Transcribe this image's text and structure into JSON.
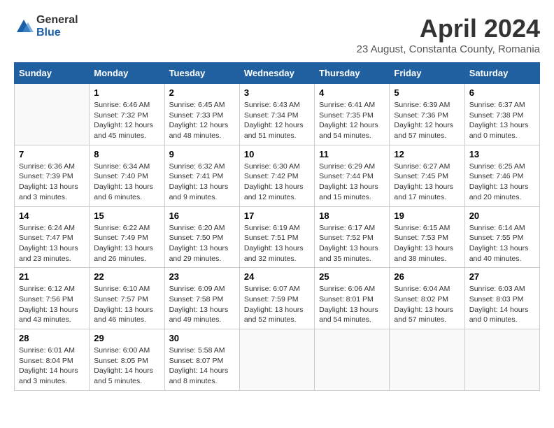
{
  "logo": {
    "general": "General",
    "blue": "Blue"
  },
  "title": "April 2024",
  "subtitle": "23 August, Constanta County, Romania",
  "days_of_week": [
    "Sunday",
    "Monday",
    "Tuesday",
    "Wednesday",
    "Thursday",
    "Friday",
    "Saturday"
  ],
  "weeks": [
    [
      {
        "day": "",
        "info": ""
      },
      {
        "day": "1",
        "info": "Sunrise: 6:46 AM\nSunset: 7:32 PM\nDaylight: 12 hours\nand 45 minutes."
      },
      {
        "day": "2",
        "info": "Sunrise: 6:45 AM\nSunset: 7:33 PM\nDaylight: 12 hours\nand 48 minutes."
      },
      {
        "day": "3",
        "info": "Sunrise: 6:43 AM\nSunset: 7:34 PM\nDaylight: 12 hours\nand 51 minutes."
      },
      {
        "day": "4",
        "info": "Sunrise: 6:41 AM\nSunset: 7:35 PM\nDaylight: 12 hours\nand 54 minutes."
      },
      {
        "day": "5",
        "info": "Sunrise: 6:39 AM\nSunset: 7:36 PM\nDaylight: 12 hours\nand 57 minutes."
      },
      {
        "day": "6",
        "info": "Sunrise: 6:37 AM\nSunset: 7:38 PM\nDaylight: 13 hours\nand 0 minutes."
      }
    ],
    [
      {
        "day": "7",
        "info": "Sunrise: 6:36 AM\nSunset: 7:39 PM\nDaylight: 13 hours\nand 3 minutes."
      },
      {
        "day": "8",
        "info": "Sunrise: 6:34 AM\nSunset: 7:40 PM\nDaylight: 13 hours\nand 6 minutes."
      },
      {
        "day": "9",
        "info": "Sunrise: 6:32 AM\nSunset: 7:41 PM\nDaylight: 13 hours\nand 9 minutes."
      },
      {
        "day": "10",
        "info": "Sunrise: 6:30 AM\nSunset: 7:42 PM\nDaylight: 13 hours\nand 12 minutes."
      },
      {
        "day": "11",
        "info": "Sunrise: 6:29 AM\nSunset: 7:44 PM\nDaylight: 13 hours\nand 15 minutes."
      },
      {
        "day": "12",
        "info": "Sunrise: 6:27 AM\nSunset: 7:45 PM\nDaylight: 13 hours\nand 17 minutes."
      },
      {
        "day": "13",
        "info": "Sunrise: 6:25 AM\nSunset: 7:46 PM\nDaylight: 13 hours\nand 20 minutes."
      }
    ],
    [
      {
        "day": "14",
        "info": "Sunrise: 6:24 AM\nSunset: 7:47 PM\nDaylight: 13 hours\nand 23 minutes."
      },
      {
        "day": "15",
        "info": "Sunrise: 6:22 AM\nSunset: 7:49 PM\nDaylight: 13 hours\nand 26 minutes."
      },
      {
        "day": "16",
        "info": "Sunrise: 6:20 AM\nSunset: 7:50 PM\nDaylight: 13 hours\nand 29 minutes."
      },
      {
        "day": "17",
        "info": "Sunrise: 6:19 AM\nSunset: 7:51 PM\nDaylight: 13 hours\nand 32 minutes."
      },
      {
        "day": "18",
        "info": "Sunrise: 6:17 AM\nSunset: 7:52 PM\nDaylight: 13 hours\nand 35 minutes."
      },
      {
        "day": "19",
        "info": "Sunrise: 6:15 AM\nSunset: 7:53 PM\nDaylight: 13 hours\nand 38 minutes."
      },
      {
        "day": "20",
        "info": "Sunrise: 6:14 AM\nSunset: 7:55 PM\nDaylight: 13 hours\nand 40 minutes."
      }
    ],
    [
      {
        "day": "21",
        "info": "Sunrise: 6:12 AM\nSunset: 7:56 PM\nDaylight: 13 hours\nand 43 minutes."
      },
      {
        "day": "22",
        "info": "Sunrise: 6:10 AM\nSunset: 7:57 PM\nDaylight: 13 hours\nand 46 minutes."
      },
      {
        "day": "23",
        "info": "Sunrise: 6:09 AM\nSunset: 7:58 PM\nDaylight: 13 hours\nand 49 minutes."
      },
      {
        "day": "24",
        "info": "Sunrise: 6:07 AM\nSunset: 7:59 PM\nDaylight: 13 hours\nand 52 minutes."
      },
      {
        "day": "25",
        "info": "Sunrise: 6:06 AM\nSunset: 8:01 PM\nDaylight: 13 hours\nand 54 minutes."
      },
      {
        "day": "26",
        "info": "Sunrise: 6:04 AM\nSunset: 8:02 PM\nDaylight: 13 hours\nand 57 minutes."
      },
      {
        "day": "27",
        "info": "Sunrise: 6:03 AM\nSunset: 8:03 PM\nDaylight: 14 hours\nand 0 minutes."
      }
    ],
    [
      {
        "day": "28",
        "info": "Sunrise: 6:01 AM\nSunset: 8:04 PM\nDaylight: 14 hours\nand 3 minutes."
      },
      {
        "day": "29",
        "info": "Sunrise: 6:00 AM\nSunset: 8:05 PM\nDaylight: 14 hours\nand 5 minutes."
      },
      {
        "day": "30",
        "info": "Sunrise: 5:58 AM\nSunset: 8:07 PM\nDaylight: 14 hours\nand 8 minutes."
      },
      {
        "day": "",
        "info": ""
      },
      {
        "day": "",
        "info": ""
      },
      {
        "day": "",
        "info": ""
      },
      {
        "day": "",
        "info": ""
      }
    ]
  ]
}
